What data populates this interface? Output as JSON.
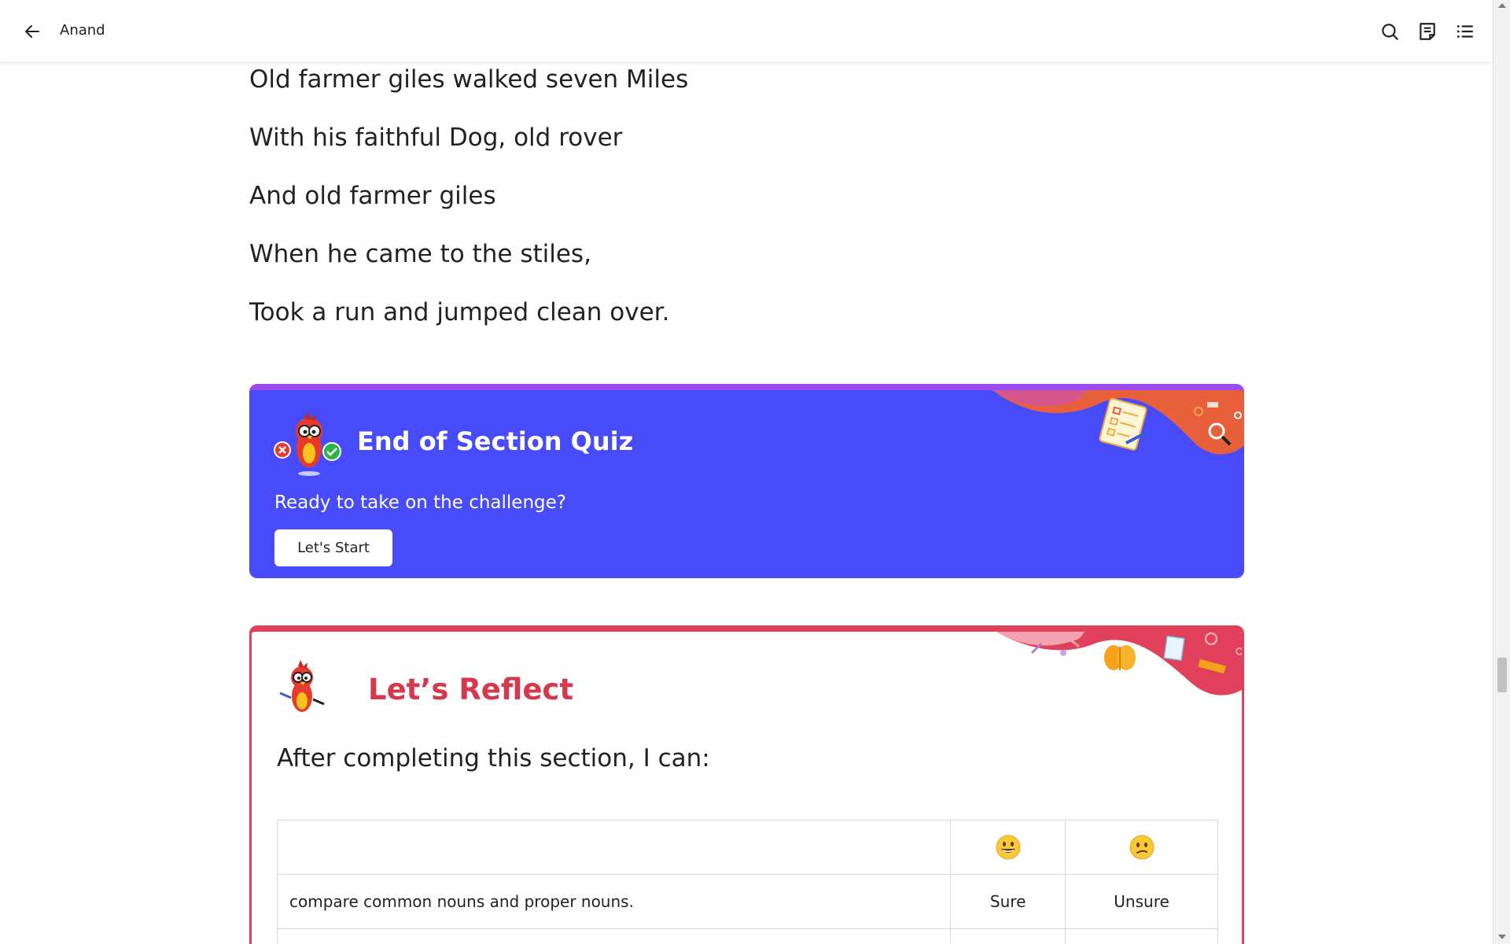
{
  "header": {
    "title": "Anand",
    "icons": [
      "back-arrow-icon",
      "search-icon",
      "notes-icon",
      "table-of-contents-icon"
    ]
  },
  "poem": {
    "lines": [
      "Old farmer giles walked seven Miles",
      "With his faithful Dog, old rover",
      "And old farmer giles",
      "When he came to the stiles,",
      "Took a run and jumped clean over."
    ]
  },
  "quiz": {
    "title": "End of Section Quiz",
    "subtitle": "Ready to take on the challenge?",
    "start_label": "Let's Start",
    "colors": {
      "background": "#474bfa",
      "top_border": "#9c49f0"
    }
  },
  "reflect": {
    "title": "Let’s Reflect",
    "lead": "After completing this section, I can:",
    "table": {
      "header_icons": [
        "grinning-face-icon",
        "confused-face-icon"
      ],
      "rows": [
        {
          "skill": "compare common nouns and proper nouns.",
          "col1": "Sure",
          "col2": "Unsure"
        }
      ]
    },
    "colors": {
      "border": "#e0405a",
      "title": "#d6384e"
    }
  }
}
